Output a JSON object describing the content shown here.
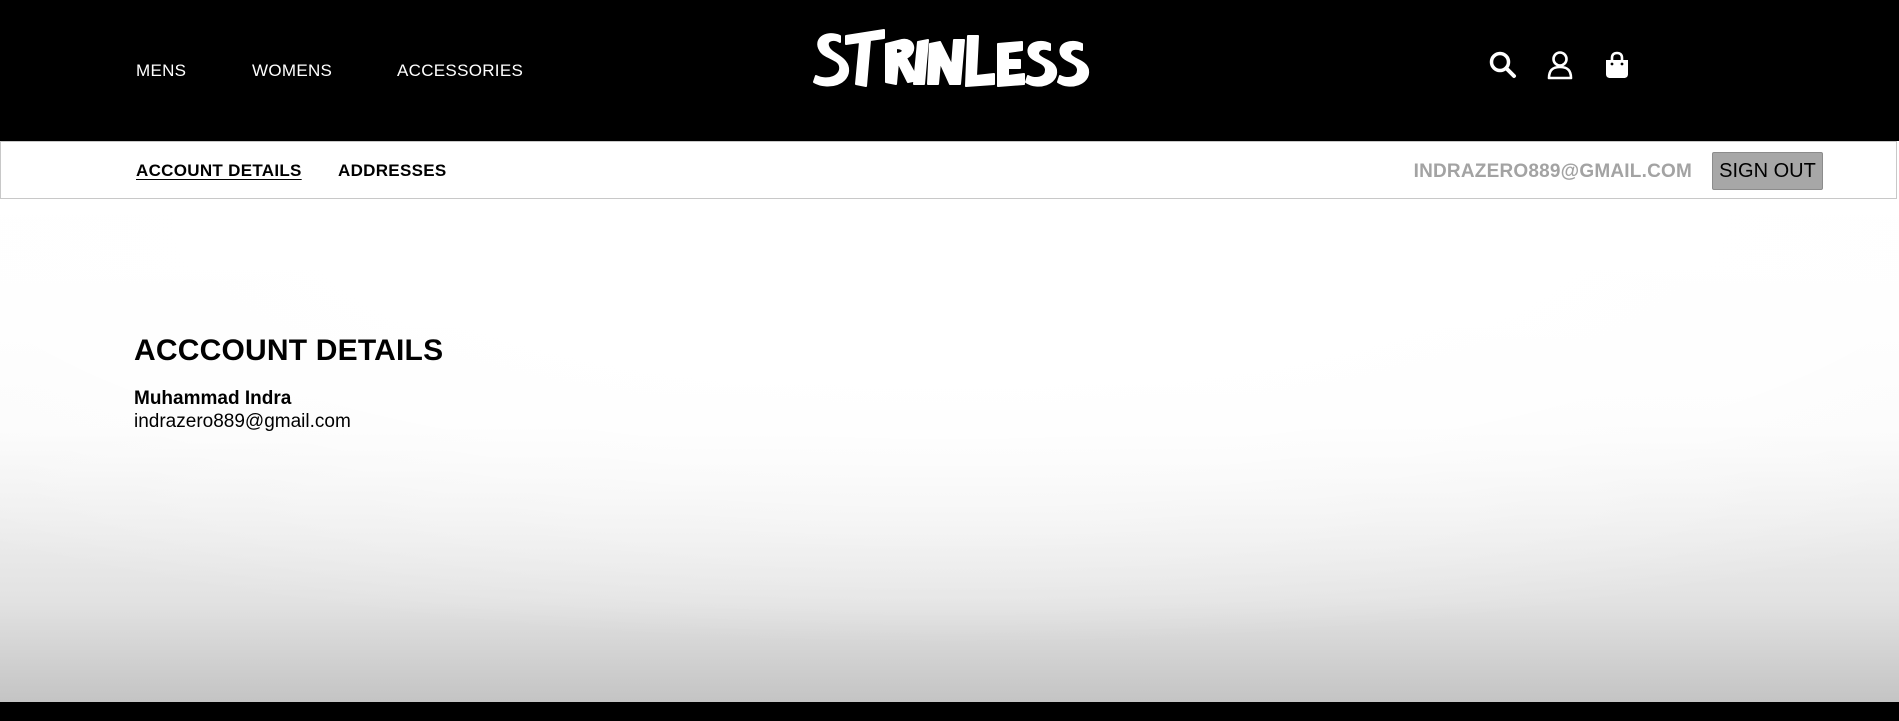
{
  "header": {
    "nav": [
      {
        "label": "MENS"
      },
      {
        "label": "WOMENS"
      },
      {
        "label": "ACCESSORIES"
      }
    ],
    "logo_text": "STRINLESS",
    "icons": [
      "search-icon",
      "account-icon",
      "shopping-bag-icon"
    ]
  },
  "account_nav": {
    "tabs": [
      {
        "label": "ACCOUNT DETAILS",
        "active": true
      },
      {
        "label": "ADDRESSES",
        "active": false
      }
    ],
    "user_email": "INDRAZERO889@GMAIL.COM",
    "sign_out_label": "SIGN OUT"
  },
  "account_details": {
    "title": "ACCCOUNT DETAILS",
    "name": "Muhammad Indra",
    "email": "indrazero889@gmail.com"
  },
  "colors": {
    "header_bg": "#000000",
    "email_text": "#a3a3a3",
    "sign_out_bg": "#a7a7a7"
  }
}
